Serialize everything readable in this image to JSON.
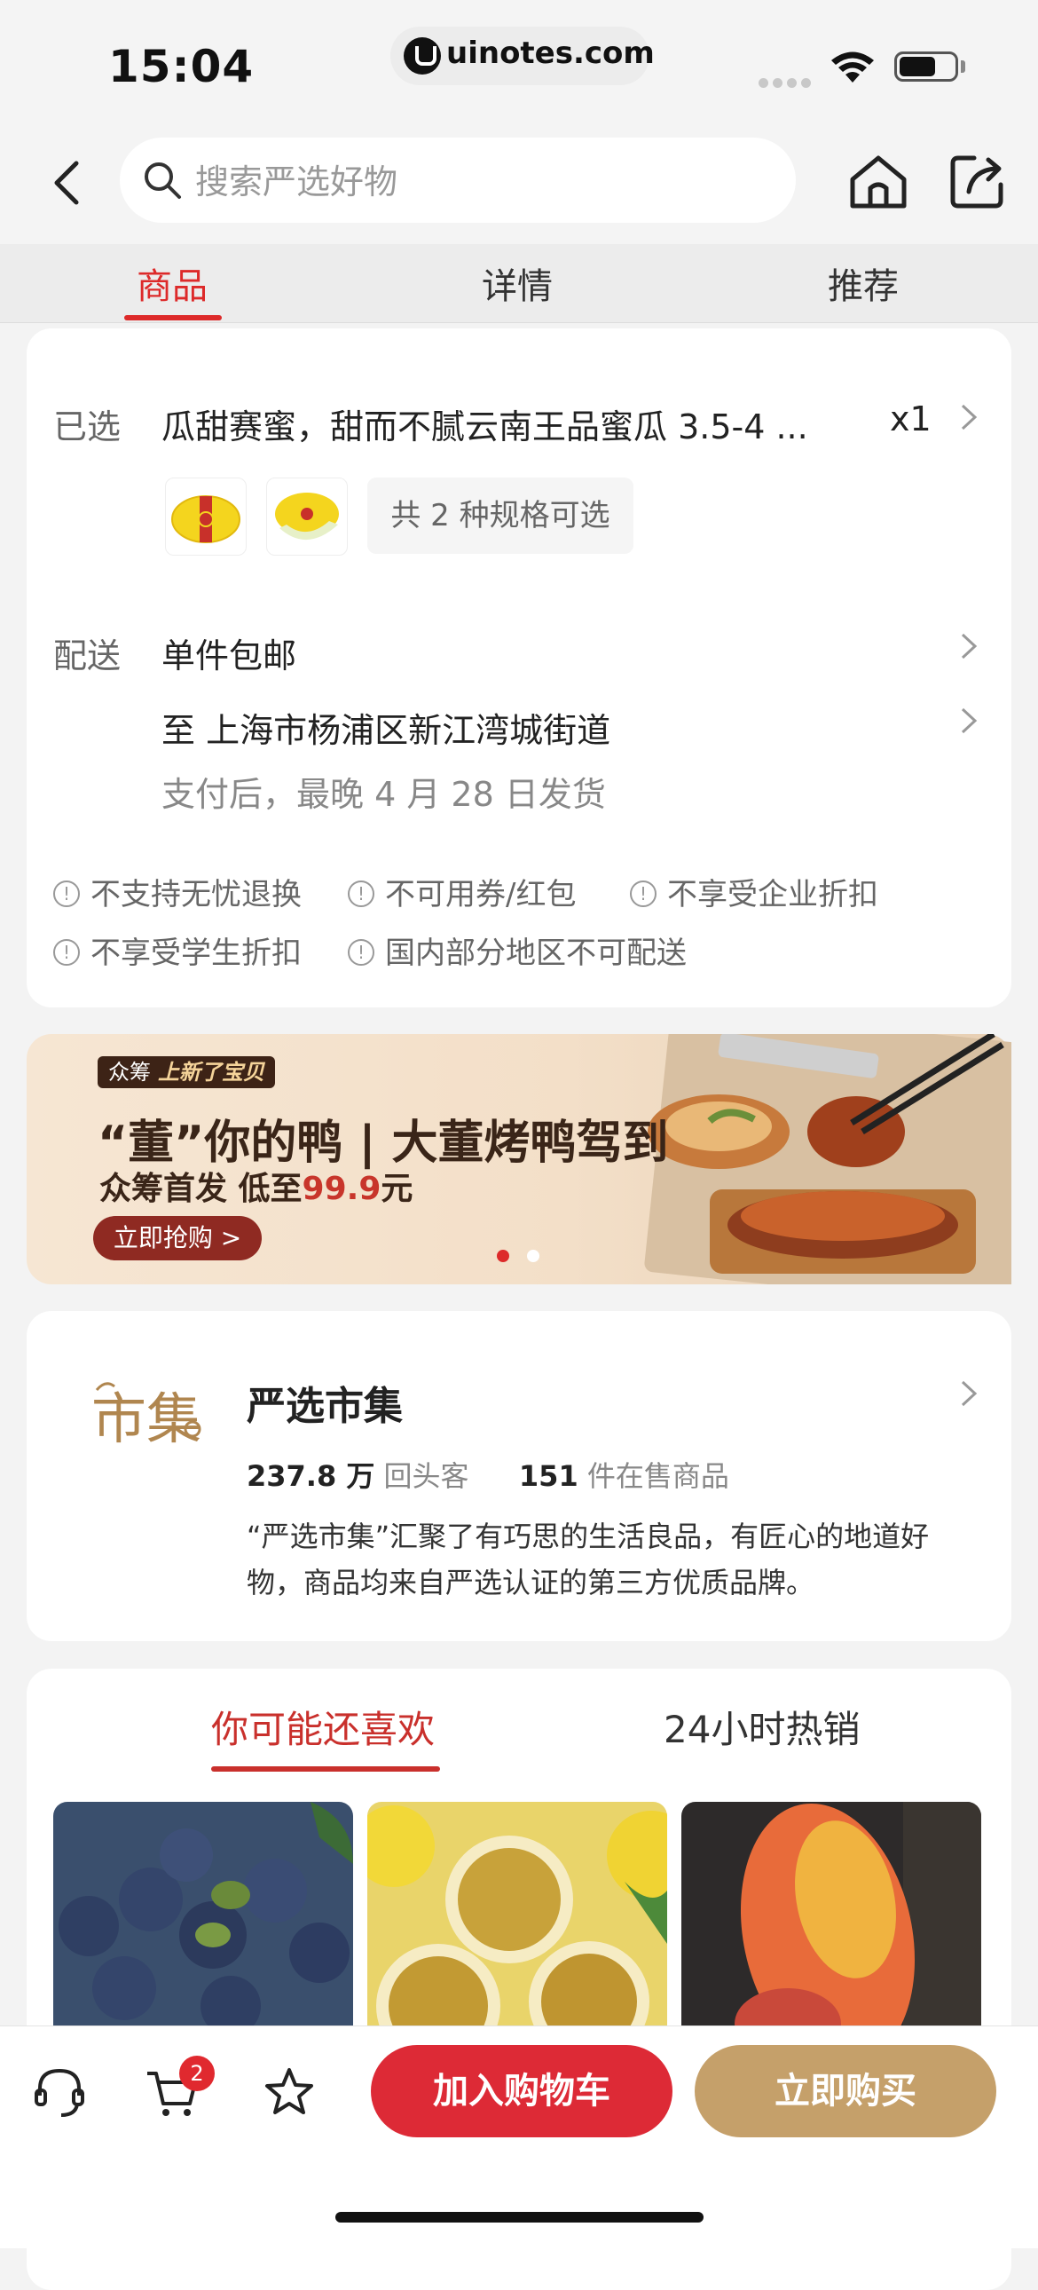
{
  "status_bar": {
    "time": "15:04",
    "url": "uinotes.com"
  },
  "search": {
    "placeholder": "搜索严选好物"
  },
  "tabs": [
    {
      "label": "商品",
      "active": true
    },
    {
      "label": "详情"
    },
    {
      "label": "推荐"
    }
  ],
  "selection": {
    "label": "已选",
    "value": "瓜甜赛蜜，甜而不腻云南王品蜜瓜 3.5-4 ...",
    "qty": "x1",
    "spec_count": "共 2 种规格可选"
  },
  "delivery": {
    "label": "配送",
    "shipping": "单件包邮",
    "address": "至 上海市杨浦区新江湾城街道",
    "eta": "支付后，最晚 4 月 28 日发货"
  },
  "notices": [
    "不支持无忧退换",
    "不可用券/红包",
    "不享受企业折扣",
    "不享受学生折扣",
    "国内部分地区不可配送"
  ],
  "banner": {
    "tag_left": "众筹",
    "tag_right": "上新了宝贝",
    "title": "“董”你的鸭 | 大董烤鸭驾到",
    "subtitle_prefix": "众筹首发 低至",
    "price": "99.9",
    "subtitle_suffix": "元",
    "button": "立即抢购 >",
    "active_dot": 0
  },
  "store": {
    "logo_text": "市集",
    "name": "严选市集",
    "repeat_customers_value": "237.8 万",
    "repeat_customers_label": "回头客",
    "products_value": "151",
    "products_label": "件在售商品",
    "description": "“严选市集”汇聚了有巧思的生活良品，有匠心的地道好物，商品均来自严选认证的第三方优质品牌。"
  },
  "recommend": {
    "tabs": [
      {
        "label": "你可能还喜欢",
        "active": true
      },
      {
        "label": "24小时热销"
      }
    ],
    "items": [
      {
        "image": "blueberries"
      },
      {
        "image": "passion-fruit"
      },
      {
        "image": "mango"
      }
    ]
  },
  "bottom_bar": {
    "cart_badge": "2",
    "add_to_cart": "加入购物车",
    "buy_now": "立即购买"
  },
  "colors": {
    "accent_red": "#dd2a2a",
    "buy_gold": "#c5a06a",
    "banner_button": "#8f2a22"
  }
}
